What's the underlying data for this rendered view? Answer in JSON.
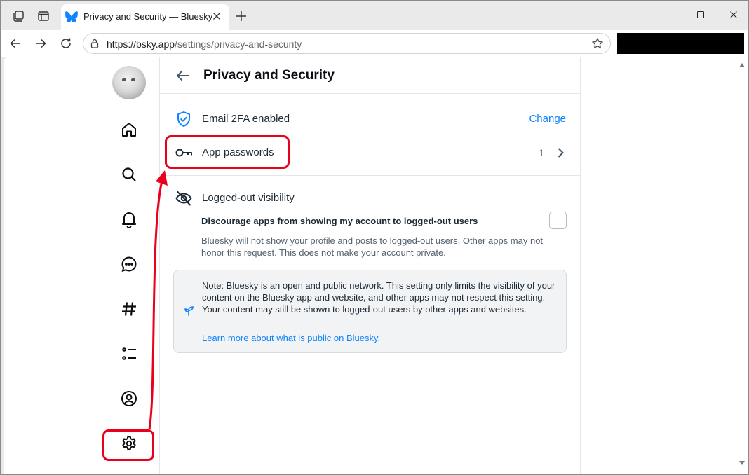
{
  "browser": {
    "tab_title": "Privacy and Security — Bluesky",
    "url_host": "https://bsky.app",
    "url_path": "/settings/privacy-and-security",
    "icons": [
      "workspaces-icon",
      "tab-actions-icon",
      "bluesky-butterfly-icon",
      "close-tab-icon",
      "new-tab-icon",
      "back-icon",
      "forward-icon",
      "refresh-icon",
      "lock-icon",
      "favorite-star-icon",
      "minimize-icon",
      "maximize-icon",
      "close-window-icon"
    ]
  },
  "sidebar": {
    "items": [
      {
        "icon": "home-icon"
      },
      {
        "icon": "search-icon"
      },
      {
        "icon": "bell-icon"
      },
      {
        "icon": "chat-icon"
      },
      {
        "icon": "hashtag-icon"
      },
      {
        "icon": "lists-icon"
      },
      {
        "icon": "profile-icon"
      },
      {
        "icon": "gear-icon"
      }
    ]
  },
  "header": {
    "title": "Privacy and Security"
  },
  "security": {
    "email_2fa_label": "Email 2FA enabled",
    "email_2fa_action": "Change",
    "app_passwords_label": "App passwords",
    "app_passwords_count": "1"
  },
  "visibility": {
    "title": "Logged-out visibility",
    "checkbox_label": "Discourage apps from showing my account to logged-out users",
    "checked": false,
    "description": "Bluesky will not show your profile and posts to logged-out users. Other apps may not honor this request. This does not make your account private.",
    "note": "Note: Bluesky is an open and public network. This setting only limits the visibility of your content on the Bluesky app and website, and other apps may not respect this setting. Your content may still be shown to logged-out users by other apps and websites.",
    "learn_more": "Learn more about what is public on Bluesky."
  },
  "colors": {
    "accent": "#1083fe",
    "annotation_red": "#e8001c"
  }
}
